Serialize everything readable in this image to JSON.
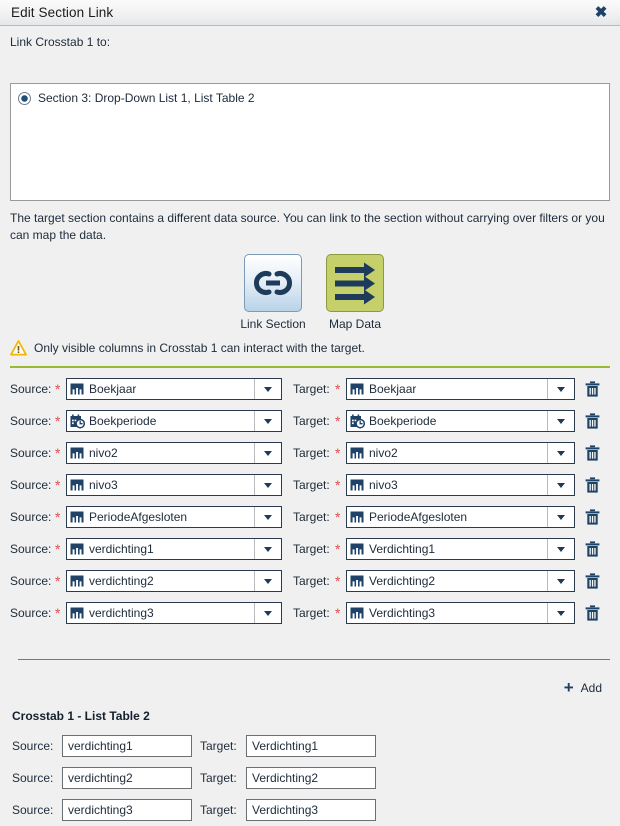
{
  "window": {
    "title": "Edit Section Link",
    "close_label": "✖"
  },
  "link_to": {
    "label": "Link Crosstab 1 to:",
    "options": [
      {
        "label": "Section 3: Drop-Down List 1, List Table 2",
        "selected": true
      }
    ]
  },
  "description": "The target section contains a different data source. You can link to the section without carrying over filters or you can map the data.",
  "mode_buttons": [
    {
      "name": "link-section",
      "caption": "Link Section",
      "icon": "chain-link-icon",
      "color": "#b9d3e8"
    },
    {
      "name": "map-data",
      "caption": "Map Data",
      "icon": "arrows-right-icon",
      "color": "#c6d06a"
    }
  ],
  "warning": {
    "icon": "warning-triangle-icon",
    "text": "Only visible columns in Crosstab 1 can interact with the target."
  },
  "mapping": {
    "source_label": "Source:",
    "target_label": "Target:",
    "required_marker": "*",
    "rows": [
      {
        "source": "Boekjaar",
        "source_icon": "column-chart-icon",
        "source_required": true,
        "target": "Boekjaar",
        "target_icon": "column-chart-icon",
        "target_required": true
      },
      {
        "source": "Boekperiode",
        "source_icon": "calendar-clock-icon",
        "source_required": true,
        "target": "Boekperiode",
        "target_icon": "calendar-clock-icon",
        "target_required": true
      },
      {
        "source": "nivo2",
        "source_icon": "column-chart-icon",
        "source_required": true,
        "target": "nivo2",
        "target_icon": "column-chart-icon",
        "target_required": true
      },
      {
        "source": "nivo3",
        "source_icon": "column-chart-icon",
        "source_required": true,
        "target": "nivo3",
        "target_icon": "column-chart-icon",
        "target_required": true
      },
      {
        "source": "PeriodeAfgesloten",
        "source_icon": "column-chart-icon",
        "source_required": true,
        "target": "PeriodeAfgesloten",
        "target_icon": "column-chart-icon",
        "target_required": true
      },
      {
        "source": "verdichting1",
        "source_icon": "column-chart-icon",
        "source_required": true,
        "target": "Verdichting1",
        "target_icon": "column-chart-icon",
        "target_required": true
      },
      {
        "source": "verdichting2",
        "source_icon": "column-chart-icon",
        "source_required": true,
        "target": "Verdichting2",
        "target_icon": "column-chart-icon",
        "target_required": true
      },
      {
        "source": "verdichting3",
        "source_icon": "column-chart-icon",
        "source_required": true,
        "target": "Verdichting3",
        "target_icon": "column-chart-icon",
        "target_required": true
      }
    ],
    "delete_icon": "trash-icon"
  },
  "add_button": {
    "label": "Add",
    "icon": "plus-icon"
  },
  "group": {
    "title": "Crosstab 1 - List Table 2",
    "source_label": "Source:",
    "target_label": "Target:",
    "rows": [
      {
        "source": "verdichting1",
        "target": "Verdichting1"
      },
      {
        "source": "verdichting2",
        "target": "Verdichting2"
      },
      {
        "source": "verdichting3",
        "target": "Verdichting3"
      }
    ]
  },
  "colors": {
    "accent_green": "#9aba36",
    "accent_navy": "#1f4267",
    "required_red": "#e04a4a",
    "warning_yellow": "#f2b50a"
  }
}
